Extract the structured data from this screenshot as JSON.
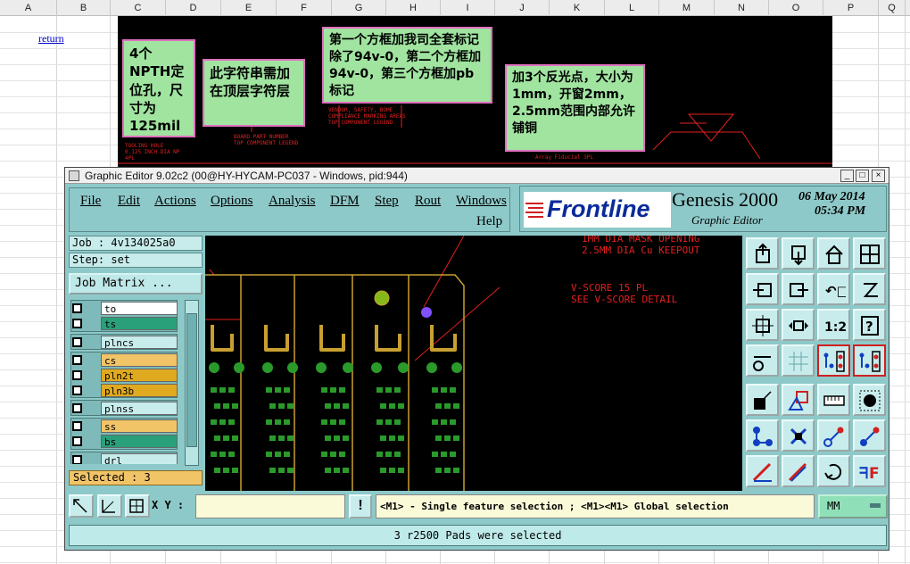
{
  "spreadsheet": {
    "columns": [
      "A",
      "B",
      "C",
      "D",
      "E",
      "F",
      "G",
      "H",
      "I",
      "J",
      "K",
      "L",
      "M",
      "N",
      "O",
      "P",
      "Q"
    ],
    "return_link": "return"
  },
  "notes": {
    "note1": "4个NPTH定位孔，尺寸为125mil",
    "note2": "此字符串需加在顶层字符层",
    "note3": "第一个方框加我司全套标记除了94v-0，第二个方框加94v-0，第三个方框加pb标记",
    "note4": "加3个反光点，大小为1mm，开窗2mm，2.5mm范围内部允许铺铜"
  },
  "pcb_labels": {
    "tooling": "TOOLING HOLE\n0.125 INCH DIA NP\n4PL",
    "board_part": "BOARD PART NUMBER\nTOP COMPONENT LEGEND",
    "vendor": "VENDOR, SAFETY, BOME\nCOMPLIANCE MARKING AREAS\nTOP COMPONENT LEGEND",
    "array_fiducial": "Array Fiducial 3PL"
  },
  "window": {
    "title": "Graphic Editor 9.02c2 (00@HY-HYCAM-PC037 - Windows, pid:944)",
    "minimize": "_",
    "maximize": "□",
    "close": "×"
  },
  "menu": {
    "file": "File",
    "edit": "Edit",
    "actions": "Actions",
    "options": "Options",
    "analysis": "Analysis",
    "dfm": "DFM",
    "step": "Step",
    "rout": "Rout",
    "windows": "Windows",
    "help": "Help"
  },
  "brand": {
    "logo": "Frontline",
    "product": "Genesis 2000",
    "subtitle": "Graphic Editor",
    "date": "06 May 2014",
    "time": "05:34 PM"
  },
  "job": {
    "job_label": "Job : 4v134025a0",
    "step_label": "Step: set",
    "job_matrix": "Job Matrix ...",
    "selected": "Selected : 3"
  },
  "layers": [
    {
      "name": "to",
      "color": "#ffffff"
    },
    {
      "name": "ts",
      "color": "#2aa07a"
    },
    {
      "name": "plncs",
      "color": "#c8ecec"
    },
    {
      "name": "cs",
      "color": "#f2c468"
    },
    {
      "name": "pln2t",
      "color": "#e0aa20"
    },
    {
      "name": "pln3b",
      "color": "#e0aa20"
    },
    {
      "name": "plnss",
      "color": "#c8ecec"
    },
    {
      "name": "ss",
      "color": "#f2c468"
    },
    {
      "name": "bs",
      "color": "#2aa07a"
    },
    {
      "name": "drl",
      "color": "#c8ecec"
    }
  ],
  "canvas_labels": {
    "mask": "1MM DIA MASK OPENING\n2.5MM DIA Cu KEEPOUT",
    "vscore": "V-SCORE 15 PL\nSEE V-SCORE DETAIL"
  },
  "toolbar_icons": [
    "move-up-icon",
    "move-down-icon",
    "home-icon",
    "window-split-icon",
    "move-left-icon",
    "move-right-icon",
    "undo-icon",
    "redo-icon",
    "zoom-fit-icon",
    "zoom-area-icon",
    "zoom-1to2-icon",
    "help-query-icon",
    "measure-icon",
    "grid-icon",
    "layer-feature-icon",
    "layer-feature-alt-icon",
    "pad-select-icon",
    "snap-icon",
    "ruler-icon",
    "circle-pad-icon",
    "connect-icon",
    "delete-icon",
    "add-line-icon",
    "add-line-alt-icon",
    "draw-icon",
    "draw-alt-icon",
    "rotate-icon",
    "mirror-icon"
  ],
  "bottom": {
    "xy_label": "X Y :",
    "xy_value": "",
    "bang": "!",
    "message": "<M1> - Single feature selection ; <M1><M1> Global selection",
    "unit": "MM",
    "status": "3 r2500 Pads were selected"
  }
}
